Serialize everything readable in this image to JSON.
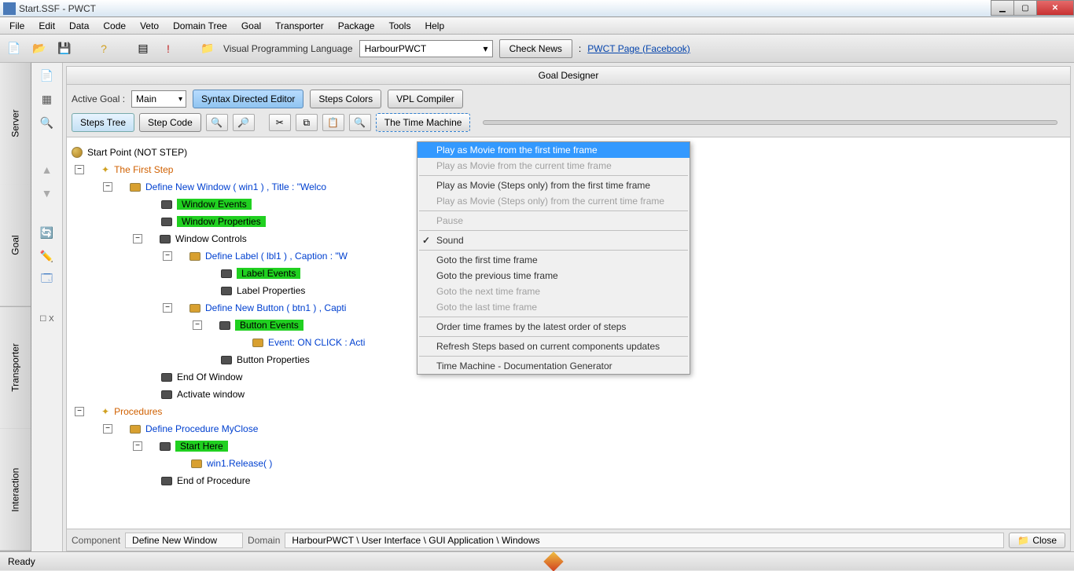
{
  "window": {
    "title": "Start.SSF - PWCT"
  },
  "menubar": [
    "File",
    "Edit",
    "Data",
    "Code",
    "Veto",
    "Domain Tree",
    "Goal",
    "Transporter",
    "Package",
    "Tools",
    "Help"
  ],
  "toolbar": {
    "label_vpl": "Visual Programming Language",
    "select_vpl": "HarbourPWCT",
    "btn_news": "Check News",
    "link_label": "PWCT Page (Facebook)",
    "colon": ":"
  },
  "sidetabs": [
    "Server",
    "Goal",
    "Transporter",
    "Interaction"
  ],
  "designer": {
    "title": "Goal Designer",
    "active_goal_label": "Active Goal :",
    "active_goal_value": "Main",
    "btn_syntax": "Syntax Directed Editor",
    "btn_colors": "Steps Colors",
    "btn_compiler": "VPL Compiler",
    "btn_stepstree": "Steps Tree",
    "btn_stepcode": "Step Code",
    "btn_timemachine": "The Time Machine"
  },
  "tree": {
    "start": "Start Point (NOT STEP)",
    "first_step": "The First Step",
    "define_window": "Define New Window  ( win1 ) , Title : \"Welco",
    "window_events": "Window Events",
    "window_props": "Window Properties",
    "window_controls": "Window Controls",
    "define_label": "Define Label ( lbl1 ) , Caption : \"W",
    "label_events": "Label Events",
    "label_props": "Label Properties",
    "define_button": "Define New Button ( btn1 ) , Capti",
    "button_events": "Button Events",
    "event_click": "Event: ON CLICK : Acti",
    "button_props": "Button Properties",
    "end_window": "End Of Window",
    "activate_window": "Activate window",
    "procedures": "Procedures",
    "define_proc": "Define Procedure MyClose",
    "start_here": "Start Here",
    "win_release": "win1.Release( )",
    "end_proc": "End of Procedure"
  },
  "dropdown": [
    {
      "label": "Play as Movie from the first time frame",
      "state": "highlighted"
    },
    {
      "label": "Play as Movie from the current time frame",
      "state": "disabled"
    },
    {
      "sep": true
    },
    {
      "label": "Play as Movie (Steps only) from the first time frame",
      "state": "normal"
    },
    {
      "label": "Play as Movie (Steps only) from the current time frame",
      "state": "disabled"
    },
    {
      "sep": true
    },
    {
      "label": "Pause",
      "state": "disabled"
    },
    {
      "sep": true
    },
    {
      "label": "Sound",
      "state": "checked"
    },
    {
      "sep": true
    },
    {
      "label": "Goto the first time frame",
      "state": "normal"
    },
    {
      "label": "Goto the previous time frame",
      "state": "normal"
    },
    {
      "label": "Goto the next time frame",
      "state": "disabled"
    },
    {
      "label": "Goto the last time frame",
      "state": "disabled"
    },
    {
      "sep": true
    },
    {
      "label": "Order time frames by the latest order of steps",
      "state": "normal"
    },
    {
      "sep": true
    },
    {
      "label": "Refresh Steps based on current components updates",
      "state": "normal"
    },
    {
      "sep": true
    },
    {
      "label": "Time Machine - Documentation Generator",
      "state": "normal"
    }
  ],
  "compbar": {
    "component_label": "Component",
    "component_value": "Define New Window",
    "domain_label": "Domain",
    "domain_value": "HarbourPWCT  \\  User Interface  \\  GUI Application  \\  Windows",
    "close": "Close"
  },
  "statusbar": {
    "ready": "Ready"
  }
}
